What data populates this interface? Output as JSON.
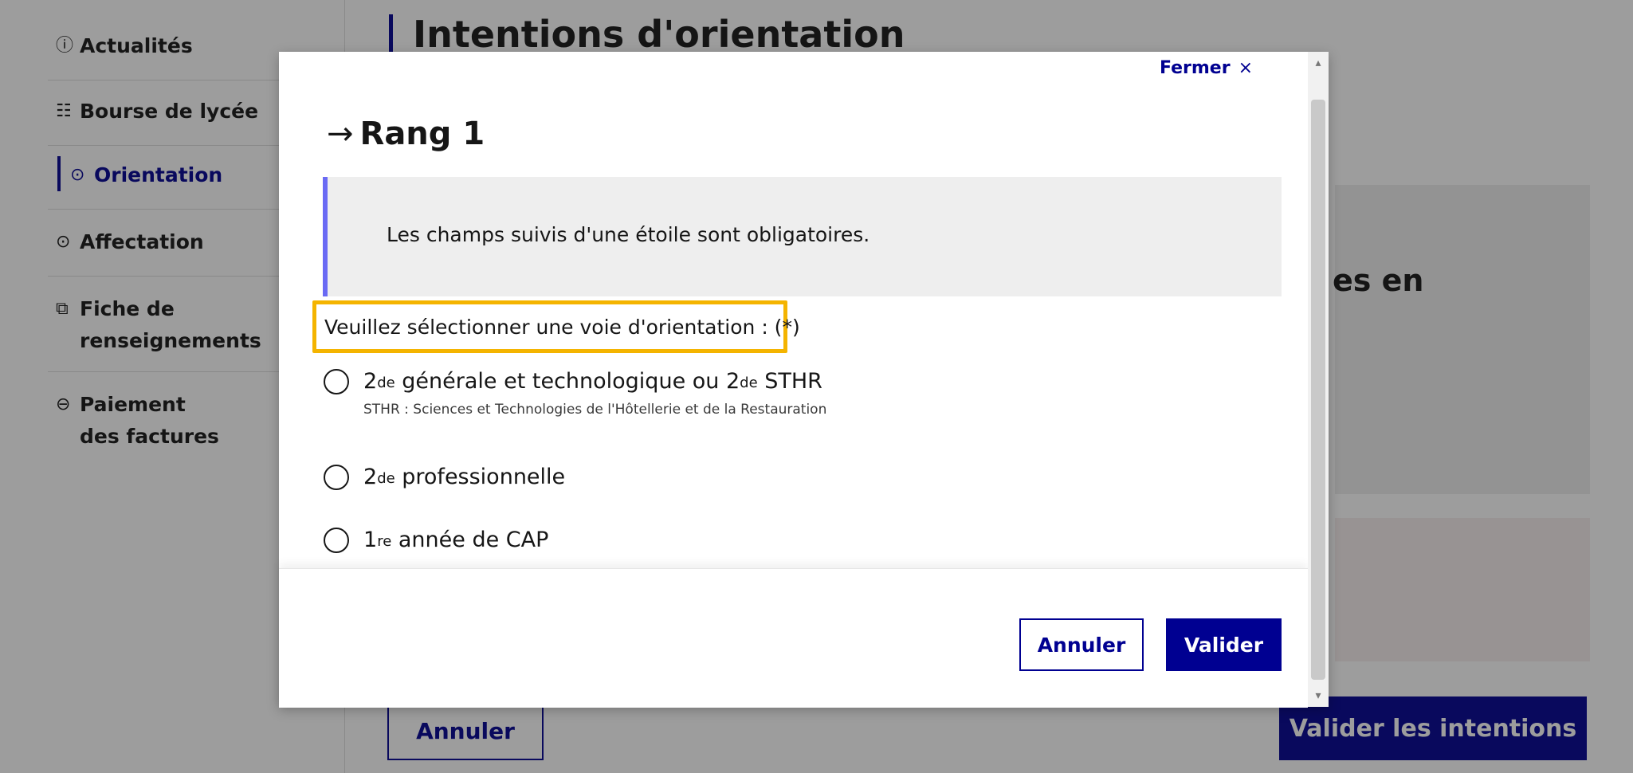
{
  "sidebar": {
    "items": [
      {
        "icon": "ⓘ",
        "label": "Actualités"
      },
      {
        "icon": "☷",
        "label": "Bourse de lycée"
      },
      {
        "icon": "⊙",
        "label": "Orientation"
      },
      {
        "icon": "⊙",
        "label": "Affectation"
      },
      {
        "icon": "⧉",
        "label": "Fiche de renseignements"
      },
      {
        "icon": "⊖",
        "label": "Paiement des factures"
      }
    ]
  },
  "page": {
    "title": "Intentions d'orientation",
    "panel_text": "es en",
    "cancel_label": "Annuler",
    "validate_label": "Valider les intentions"
  },
  "modal": {
    "close_label": "Fermer",
    "close_icon": "×",
    "title_arrow": "→",
    "title": "Rang 1",
    "notice": "Les champs suivis d'une étoile sont obligatoires.",
    "legend": "Veuillez sélectionner une voie d'orientation : (*)",
    "options": [
      {
        "sup": "2de",
        "label": " générale et technologique ou 2",
        "sup2": "de",
        "label2": " STHR",
        "hint": "STHR : Sciences et Technologies de l'Hôtellerie et de la Restauration",
        "checked": false
      },
      {
        "sup": "2de",
        "label": " professionnelle",
        "checked": false
      },
      {
        "sup": "1re",
        "label": " année de CAP",
        "checked": false
      }
    ],
    "cancel_label": "Annuler",
    "validate_label": "Valider"
  },
  "colors": {
    "primary": "#000091",
    "callout_bar": "#6a6af4",
    "highlight": "#f4b400"
  }
}
